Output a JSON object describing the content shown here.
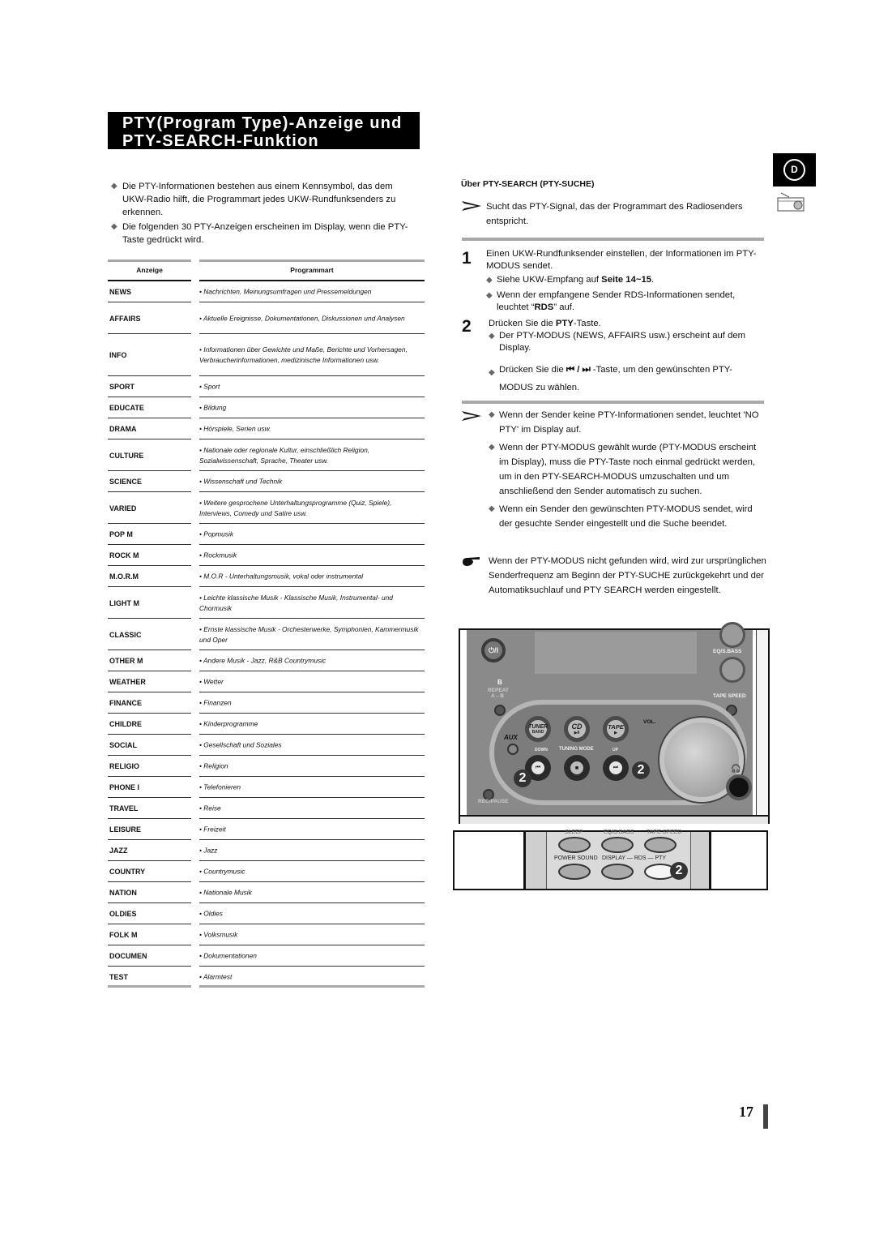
{
  "title": {
    "line1": "PTY(Program Type)-Anzeige und",
    "line2": "PTY-SEARCH-Funktion"
  },
  "intro": [
    "Die PTY-Informationen bestehen aus einem Kennsymbol, das dem UKW-Radio hilft, die Programmart jedes UKW-Rundfunksenders zu erkennen.",
    "Die folgenden 30 PTY-Anzeigen erscheinen im Display, wenn die PTY-Taste gedrückt wird."
  ],
  "table": {
    "headers": [
      "Anzeige",
      "Programmart"
    ],
    "rows": [
      {
        "code": "NEWS",
        "desc": "• Nachrichten, Meinungsumfragen und Pressemeldungen"
      },
      {
        "code": "AFFAIRS",
        "desc": "• Aktuelle Ereignisse, Dokumentationen, Diskussionen und Analysen"
      },
      {
        "code": "INFO",
        "desc": "• Informationen über Gewichte und Maße, Berichte und Vorhersagen, Verbraucherinformationen, medizinische Informationen usw."
      },
      {
        "code": "SPORT",
        "desc": "• Sport"
      },
      {
        "code": "EDUCATE",
        "desc": "• Bildung"
      },
      {
        "code": "DRAMA",
        "desc": "• Hörspiele, Serien usw."
      },
      {
        "code": "CULTURE",
        "desc": "• Nationale oder regionale Kultur, einschließlich Religion, Sozialwissenschaft, Sprache, Theater usw."
      },
      {
        "code": "SCIENCE",
        "desc": "• Wissenschaft und Technik"
      },
      {
        "code": "VARIED",
        "desc": "• Weitere gesprochene Unterhaltungsprogramme (Quiz, Spiele), Interviews, Comedy und Satire usw."
      },
      {
        "code": "POP M",
        "desc": "• Popmusik"
      },
      {
        "code": "ROCK M",
        "desc": "• Rockmusik"
      },
      {
        "code": "M.O.R.M",
        "desc": "• M.O.R - Unterhaltungsmusik, vokal oder instrumental"
      },
      {
        "code": "LIGHT M",
        "desc": "• Leichte klassische Musik - Klassische Musik, Instrumental- und Chormusik"
      },
      {
        "code": "CLASSIC",
        "desc": "• Ernste klassische Musik - Orchesterwerke, Symphonien, Kammermusik und Oper"
      },
      {
        "code": "OTHER M",
        "desc": "• Andere Musik - Jazz, R&B Countrymusic"
      },
      {
        "code": "WEATHER",
        "desc": "• Wetter"
      },
      {
        "code": "FINANCE",
        "desc": "• Finanzen"
      },
      {
        "code": "CHILDRE",
        "desc": "• Kinderprogramme"
      },
      {
        "code": "SOCIAL",
        "desc": "• Gesellschaft und Soziales"
      },
      {
        "code": "RELIGIO",
        "desc": "• Religion"
      },
      {
        "code": "PHONE I",
        "desc": "• Telefonieren"
      },
      {
        "code": "TRAVEL",
        "desc": "• Reise"
      },
      {
        "code": "LEISURE",
        "desc": "• Freizeit"
      },
      {
        "code": "JAZZ",
        "desc": "• Jazz"
      },
      {
        "code": "COUNTRY",
        "desc": "• Countrymusic"
      },
      {
        "code": "NATION",
        "desc": "• Nationale Musik"
      },
      {
        "code": "OLDIES",
        "desc": "• Oldies"
      },
      {
        "code": "FOLK M",
        "desc": "• Volksmusik"
      },
      {
        "code": "DOCUMEN",
        "desc": "• Dokumentationen"
      },
      {
        "code": "TEST",
        "desc": "• Alarmtest"
      }
    ]
  },
  "side_tab": {
    "letter": "D"
  },
  "search": {
    "title": "Über PTY-SEARCH (PTY-SUCHE)",
    "note": "Sucht das PTY-Signal, das der Programmart des Radiosenders entspricht."
  },
  "steps": [
    {
      "num": "1",
      "text": "Einen UKW-Rundfunksender einstellen, der Informationen im PTY-MODUS sendet.",
      "subs": [
        {
          "pre": "Siehe UKW-Empfang auf ",
          "bold": "Seite 14~15",
          "post": "."
        },
        {
          "pre": "Wenn der empfangene Sender RDS-Informationen sendet, leuchtet “",
          "bold": "RDS",
          "post": "” auf."
        }
      ]
    },
    {
      "num": "2",
      "text_pre": "Drücken Sie die ",
      "text_bold": "PTY",
      "text_post": "-Taste.",
      "subs": [
        {
          "pre": "Der PTY-MODUS (NEWS, AFFAIRS usw.) erscheint auf dem Display.",
          "bold": "",
          "post": ""
        },
        {
          "pre": "Drücken Sie die ",
          "icons": "⏮ / ⏭",
          "post": " -Taste, um den gewünschten PTY-MODUS zu wählen."
        }
      ]
    }
  ],
  "notes": [
    "Wenn der Sender keine PTY-Informationen sendet, leuchtet 'NO PTY' im Display auf.",
    "Wenn der PTY-MODUS gewählt wurde (PTY-MODUS erscheint im Display), muss die PTY-Taste noch einmal gedrückt werden, um in den PTY-SEARCH-MODUS umzuschalten und um anschließend den Sender automatisch zu suchen.",
    "Wenn ein Sender den gewünschten PTY-MODUS sendet, wird der gesuchte Sender eingestellt und die Suche beendet."
  ],
  "hand_note": "Wenn der PTY-MODUS nicht gefunden wird, wird zur ursprünglichen Senderfrequenz am Beginn der PTY-SUCHE zurückgekehrt und der Automatiksuchlauf und PTY SEARCH werden eingestellt.",
  "device": {
    "power": "⏻/I",
    "eq_label": "EQ/S.BASS",
    "repeat_b": "B",
    "repeat_label": "REPEAT",
    "repeat_ab": "A↔B",
    "tape_speed": "TAPE SPEED",
    "tuner": "TUNER",
    "tuner_sub": "BAND",
    "cd": "CD",
    "cd_sub": "▶II",
    "tape": "TAPE",
    "tape_sub": "▶",
    "aux": "AUX",
    "vol": "VOL.",
    "down": "DOWN",
    "tuning_mode": "TUNING MODE",
    "up": "UP",
    "rec_pause": "REC/PAUSE",
    "prev": "⏮",
    "stop": "■",
    "next": "⏭",
    "step_badge": "2"
  },
  "remote": {
    "top_labels": [
      "SLEEP",
      "EQ/S.BASS",
      "TAPE SPEED"
    ],
    "power_sound": "POWER SOUND",
    "display_rds_pty": "DISPLAY — RDS — PTY",
    "step_badge": "2"
  },
  "page_number": "17"
}
